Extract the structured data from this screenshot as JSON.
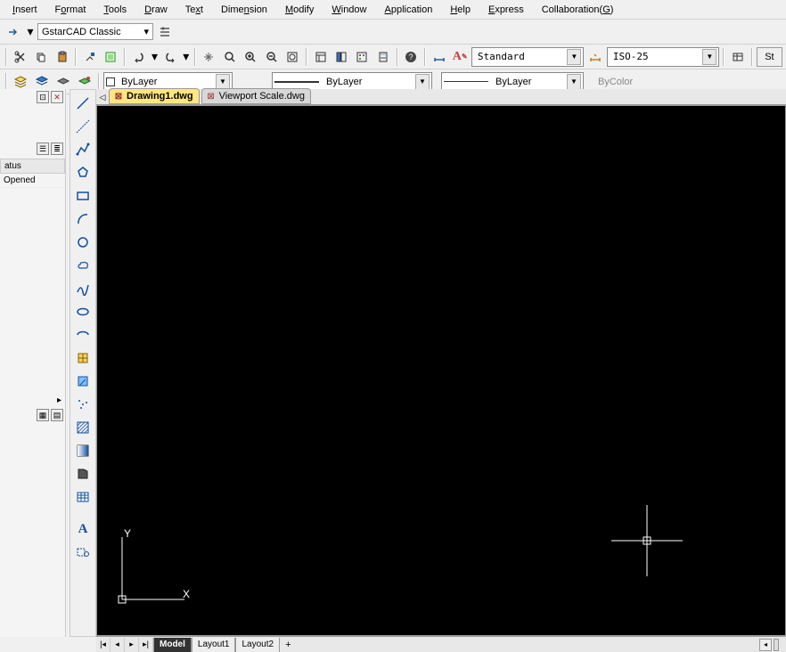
{
  "menu": {
    "items": [
      "Insert",
      "Format",
      "Tools",
      "Draw",
      "Text",
      "Dimension",
      "Modify",
      "Window",
      "Application",
      "Help",
      "Express",
      "Collaboration(G)"
    ]
  },
  "workspace": {
    "value": "GstarCAD Classic"
  },
  "styles": {
    "text_style": "Standard",
    "dim_style": "ISO-25",
    "layer": "ByLayer",
    "linetype": "ByLayer",
    "lineweight": "ByLayer",
    "color": "ByColor",
    "st_button": "St"
  },
  "tabs": {
    "active": "Drawing1.dwg",
    "list": [
      {
        "name": "Drawing1.dwg",
        "active": true
      },
      {
        "name": "Viewport Scale.dwg",
        "active": false
      }
    ]
  },
  "left_panel": {
    "col_status": "atus",
    "row_opened": "Opened"
  },
  "bottom_tabs": {
    "list": [
      "Model",
      "Layout1",
      "Layout2"
    ],
    "active": "Model",
    "plus": "+"
  },
  "ucs": {
    "x": "X",
    "y": "Y"
  }
}
